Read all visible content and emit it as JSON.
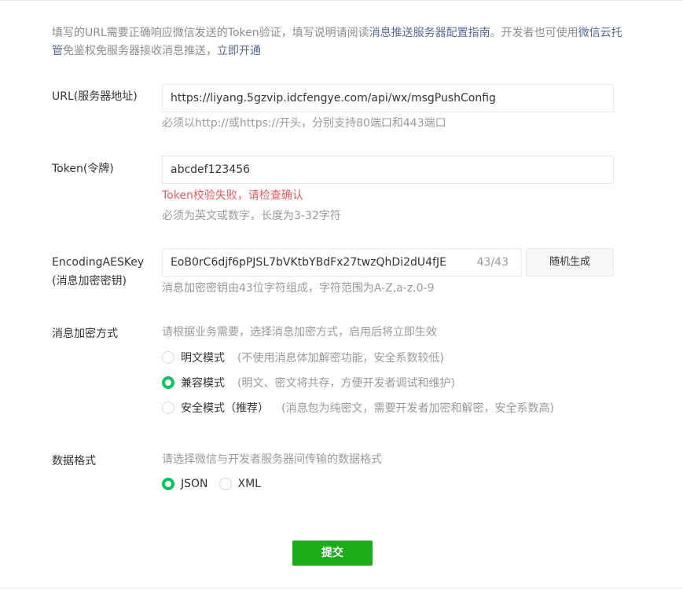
{
  "intro": {
    "part1": "填写的URL需要正确响应微信发送的Token验证，填写说明请阅读",
    "link1": "消息推送服务器配置指南",
    "part2": "。开发者也可使用",
    "link2": "微信云托管",
    "part3": "免鉴权免服务器接收消息推送，",
    "link3": "立即开通"
  },
  "url": {
    "label": "URL(服务器地址)",
    "value": "https://liyang.5gzvip.idcfengye.com/api/wx/msgPushConfig",
    "hint": "必须以http://或https://开头，分别支持80端口和443端口"
  },
  "token": {
    "label": "Token(令牌)",
    "value": "abcdef123456",
    "error": "Token校验失败，请检查确认",
    "hint": "必须为英文或数字，长度为3-32字符"
  },
  "aeskey": {
    "label_line1": "EncodingAESKey",
    "label_line2": "(消息加密密钥)",
    "value": "EoB0rC6djf6pPJSL7bVKtbYBdFx27twzQhDi2dU4fJE",
    "counter": "43/43",
    "random_button": "随机生成",
    "hint": "消息加密密钥由43位字符组成，字符范围为A-Z,a-z,0-9"
  },
  "encryption": {
    "label": "消息加密方式",
    "hint": "请根据业务需要，选择消息加密方式，启用后将立即生效",
    "options": [
      {
        "label": "明文模式",
        "desc": "(不使用消息体加解密功能，安全系数较低)",
        "checked": false
      },
      {
        "label": "兼容模式",
        "desc": "(明文、密文将共存，方便开发者调试和维护)",
        "checked": true
      },
      {
        "label": "安全模式（推荐）",
        "desc": "(消息包为纯密文，需要开发者加密和解密，安全系数高)",
        "checked": false
      }
    ]
  },
  "format": {
    "label": "数据格式",
    "hint": "请选择微信与开发者服务器间传输的数据格式",
    "options": [
      {
        "label": "JSON",
        "checked": true
      },
      {
        "label": "XML",
        "checked": false
      }
    ]
  },
  "submit_label": "提交",
  "colors": {
    "accent_green": "#07c160",
    "submit_green": "#1aad19",
    "error_red": "#e15f63",
    "link_blue": "#576b95"
  }
}
